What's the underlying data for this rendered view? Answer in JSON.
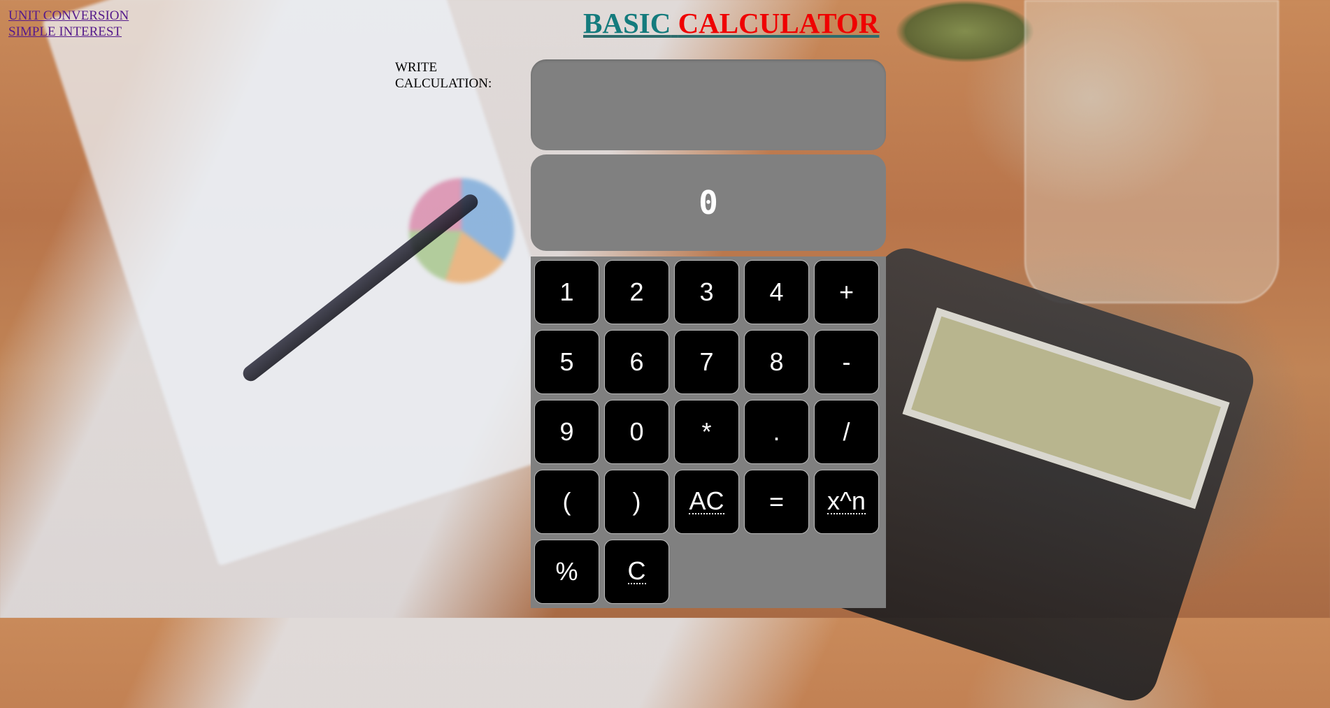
{
  "nav": {
    "links": [
      "UNIT CONVERSION",
      "SIMPLE INTEREST"
    ]
  },
  "title": {
    "part1": "BASIC",
    "part2": "CALCULATOR"
  },
  "calculator": {
    "write_label_line1": "WRITE",
    "write_label_line2": "CALCULATION:",
    "input_value": "",
    "result": "0",
    "keys": [
      "1",
      "2",
      "3",
      "4",
      "+",
      "5",
      "6",
      "7",
      "8",
      "-",
      "9",
      "0",
      "*",
      ".",
      "/",
      "(",
      ")",
      "AC",
      "=",
      "x^n",
      "%",
      "C"
    ]
  },
  "colors": {
    "title_part1": "#147b7d",
    "title_part2": "#ef0000",
    "panel": "#808080",
    "key_bg": "#000000",
    "key_text": "#ffffff"
  }
}
